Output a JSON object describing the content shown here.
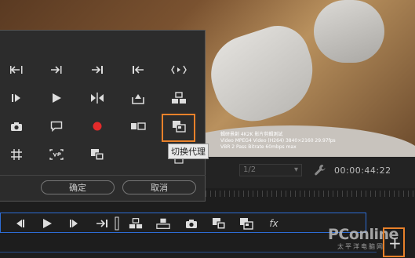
{
  "preview": {
    "overlay_lines": [
      "輯研景創 4K2K 影片剪輯測試",
      "Video MPEG4 Video (H264) 3840×2160 29.97fps",
      "VBR 2 Pass Bitrate 60mbps max"
    ]
  },
  "playback": {
    "page_select": "1/2",
    "timecode": "00:00:44:22"
  },
  "button_editor": {
    "tooltip": "切换代理",
    "ok_label": "确定",
    "cancel_label": "取消",
    "icons": [
      "mark-in-icon",
      "mark-out-icon",
      "go-to-out-icon",
      "go-to-in-icon",
      "mark-clip-icon",
      "step-back-icon",
      "play-icon",
      "trim-icon",
      "export-frame-icon",
      "multicam-icon",
      "camera-icon",
      "comment-icon",
      "record-icon",
      "compare-view-icon",
      "toggle-proxy-icon",
      "safe-margins-icon",
      "vr-icon",
      "overlay-icon"
    ]
  },
  "transport": {
    "icons": [
      "step-back-icon",
      "play-icon",
      "step-forward-icon",
      "go-to-out-icon",
      "divider",
      "insert-icon",
      "overwrite-icon",
      "export-frame-icon",
      "multicam-icon",
      "toggle-proxy-icon",
      "fx-icon"
    ],
    "fx_label": "fx"
  },
  "watermark": {
    "brand": "PConline",
    "sub": "太平洋电脑网"
  },
  "colors": {
    "highlight": "#e8812a",
    "record": "#e32b2b",
    "selection_border": "#2d6cd4"
  }
}
